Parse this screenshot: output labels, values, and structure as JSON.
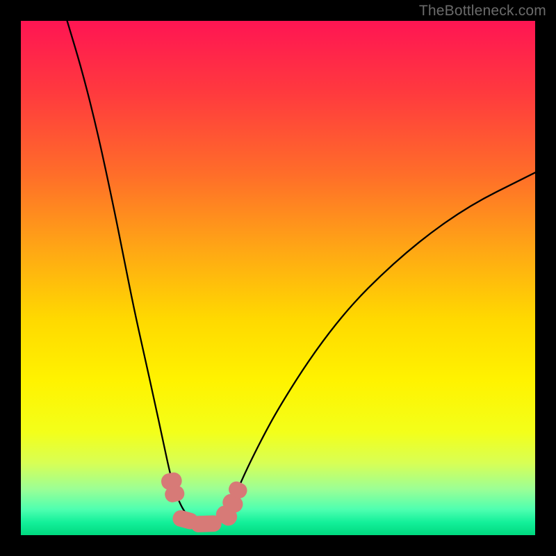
{
  "watermark": "TheBottleneck.com",
  "chart_data": {
    "type": "line",
    "title": "",
    "xlabel": "",
    "ylabel": "",
    "xlim": [
      0,
      100
    ],
    "ylim": [
      0,
      100
    ],
    "legend": false,
    "grid": false,
    "background_gradient_stops": [
      {
        "offset": 0.0,
        "color": "#ff1553"
      },
      {
        "offset": 0.14,
        "color": "#ff3a3e"
      },
      {
        "offset": 0.3,
        "color": "#ff6e29"
      },
      {
        "offset": 0.45,
        "color": "#ffa914"
      },
      {
        "offset": 0.58,
        "color": "#ffd900"
      },
      {
        "offset": 0.7,
        "color": "#fff300"
      },
      {
        "offset": 0.8,
        "color": "#f3ff1a"
      },
      {
        "offset": 0.86,
        "color": "#d8ff55"
      },
      {
        "offset": 0.91,
        "color": "#9cff95"
      },
      {
        "offset": 0.95,
        "color": "#4effb0"
      },
      {
        "offset": 0.975,
        "color": "#13f09a"
      },
      {
        "offset": 1.0,
        "color": "#00d97f"
      }
    ],
    "series": [
      {
        "name": "bottleneck-curve",
        "stroke": "#000000",
        "stroke_width": 2.3,
        "points": [
          {
            "x": 9.0,
            "y": 100.0
          },
          {
            "x": 12.0,
            "y": 90.0
          },
          {
            "x": 15.0,
            "y": 78.0
          },
          {
            "x": 18.0,
            "y": 64.0
          },
          {
            "x": 20.0,
            "y": 54.0
          },
          {
            "x": 22.0,
            "y": 44.0
          },
          {
            "x": 24.0,
            "y": 35.0
          },
          {
            "x": 26.0,
            "y": 26.0
          },
          {
            "x": 27.5,
            "y": 19.0
          },
          {
            "x": 29.0,
            "y": 12.0
          },
          {
            "x": 30.0,
            "y": 8.5
          },
          {
            "x": 31.0,
            "y": 6.0
          },
          {
            "x": 32.0,
            "y": 4.3
          },
          {
            "x": 33.0,
            "y": 3.2
          },
          {
            "x": 34.0,
            "y": 2.5
          },
          {
            "x": 35.0,
            "y": 2.1
          },
          {
            "x": 36.0,
            "y": 2.0
          },
          {
            "x": 37.0,
            "y": 2.1
          },
          {
            "x": 38.0,
            "y": 2.5
          },
          {
            "x": 39.0,
            "y": 3.2
          },
          {
            "x": 40.0,
            "y": 4.3
          },
          {
            "x": 41.0,
            "y": 6.0
          },
          {
            "x": 42.0,
            "y": 8.5
          },
          {
            "x": 44.0,
            "y": 13.0
          },
          {
            "x": 47.0,
            "y": 19.0
          },
          {
            "x": 50.0,
            "y": 24.5
          },
          {
            "x": 55.0,
            "y": 32.5
          },
          {
            "x": 60.0,
            "y": 39.5
          },
          {
            "x": 65.0,
            "y": 45.5
          },
          {
            "x": 70.0,
            "y": 50.5
          },
          {
            "x": 75.0,
            "y": 55.0
          },
          {
            "x": 80.0,
            "y": 59.0
          },
          {
            "x": 85.0,
            "y": 62.5
          },
          {
            "x": 90.0,
            "y": 65.5
          },
          {
            "x": 95.0,
            "y": 68.0
          },
          {
            "x": 100.0,
            "y": 70.5
          }
        ]
      },
      {
        "name": "highlight-markers",
        "stroke": "#d77a77",
        "marker_shape": "rounded",
        "markers": [
          {
            "x": 29.3,
            "y": 10.5,
            "w": 3.2,
            "h": 4.0,
            "rot": 78
          },
          {
            "x": 29.9,
            "y": 8.0,
            "w": 3.0,
            "h": 3.8,
            "rot": 76
          },
          {
            "x": 32.0,
            "y": 3.0,
            "w": 5.0,
            "h": 3.2,
            "rot": 15
          },
          {
            "x": 36.0,
            "y": 2.2,
            "w": 6.0,
            "h": 3.2,
            "rot": -2
          },
          {
            "x": 40.0,
            "y": 3.8,
            "w": 3.4,
            "h": 4.2,
            "rot": -55
          },
          {
            "x": 41.2,
            "y": 6.2,
            "w": 3.2,
            "h": 4.0,
            "rot": -62
          },
          {
            "x": 42.2,
            "y": 8.8,
            "w": 3.0,
            "h": 3.6,
            "rot": -65
          }
        ]
      }
    ]
  }
}
